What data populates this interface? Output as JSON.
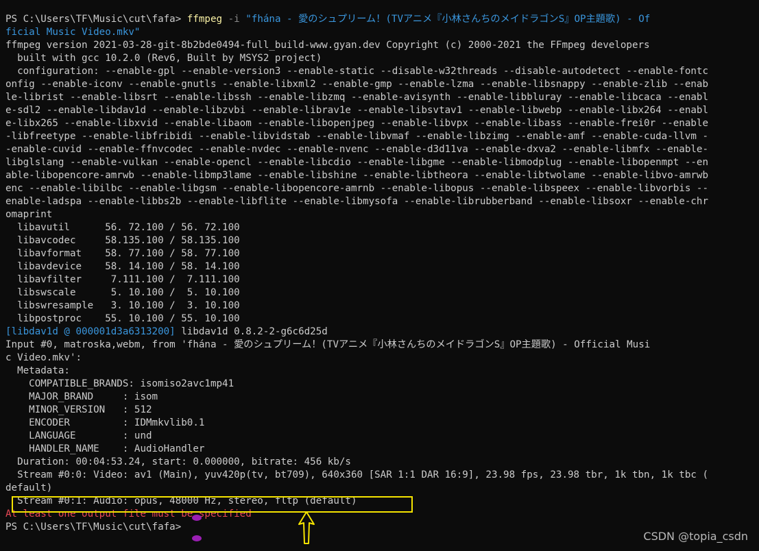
{
  "terminal": {
    "prompt": "PS C:\\Users\\TF\\Music\\cut\\fafa>",
    "command": "ffmpeg",
    "flag": "-i",
    "arg_line1": "\"fhána - 愛のシュプリーム！(TVアニメ『小林さんちのメイドラゴンS』OP主題歌) - Of",
    "arg_line2": "ficial Music Video.mkv\"",
    "lines": [
      "ffmpeg version 2021-03-28-git-8b2bde0494-full_build-www.gyan.dev Copyright (c) 2000-2021 the FFmpeg developers",
      "  built with gcc 10.2.0 (Rev6, Built by MSYS2 project)",
      "  configuration: --enable-gpl --enable-version3 --enable-static --disable-w32threads --disable-autodetect --enable-fontc",
      "onfig --enable-iconv --enable-gnutls --enable-libxml2 --enable-gmp --enable-lzma --enable-libsnappy --enable-zlib --enab",
      "le-librist --enable-libsrt --enable-libssh --enable-libzmq --enable-avisynth --enable-libbluray --enable-libcaca --enabl",
      "e-sdl2 --enable-libdav1d --enable-libzvbi --enable-librav1e --enable-libsvtav1 --enable-libwebp --enable-libx264 --enabl",
      "e-libx265 --enable-libxvid --enable-libaom --enable-libopenjpeg --enable-libvpx --enable-libass --enable-frei0r --enable",
      "-libfreetype --enable-libfribidi --enable-libvidstab --enable-libvmaf --enable-libzimg --enable-amf --enable-cuda-llvm -",
      "-enable-cuvid --enable-ffnvcodec --enable-nvdec --enable-nvenc --enable-d3d11va --enable-dxva2 --enable-libmfx --enable-",
      "libglslang --enable-vulkan --enable-opencl --enable-libcdio --enable-libgme --enable-libmodplug --enable-libopenmpt --en",
      "able-libopencore-amrwb --enable-libmp3lame --enable-libshine --enable-libtheora --enable-libtwolame --enable-libvo-amrwb",
      "enc --enable-libilbc --enable-libgsm --enable-libopencore-amrnb --enable-libopus --enable-libspeex --enable-libvorbis --",
      "enable-ladspa --enable-libbs2b --enable-libflite --enable-libmysofa --enable-librubberband --enable-libsoxr --enable-chr",
      "omaprint",
      "  libavutil      56. 72.100 / 56. 72.100",
      "  libavcodec     58.135.100 / 58.135.100",
      "  libavformat    58. 77.100 / 58. 77.100",
      "  libavdevice    58. 14.100 / 58. 14.100",
      "  libavfilter     7.111.100 /  7.111.100",
      "  libswscale      5. 10.100 /  5. 10.100",
      "  libswresample   3. 10.100 /  3. 10.100",
      "  libpostproc    55. 10.100 / 55. 10.100"
    ],
    "dav1d_tag": "[libdav1d @ 000001d3a6313200]",
    "dav1d_msg": " libdav1d 0.8.2-2-g6c6d25d",
    "input_lines": [
      "Input #0, matroska,webm, from 'fhána - 愛のシュプリーム！(TVアニメ『小林さんちのメイドラゴンS』OP主題歌) - Official Musi",
      "c Video.mkv':",
      "  Metadata:",
      "    COMPATIBLE_BRANDS: isomiso2avc1mp41",
      "    MAJOR_BRAND     : isom",
      "    MINOR_VERSION   : 512",
      "    ENCODER         : IDMmkvlib0.1",
      "    LANGUAGE        : und",
      "    HANDLER_NAME    : AudioHandler",
      "  Duration: 00:04:53.24, start: 0.000000, bitrate: 456 kb/s",
      "  Stream #0:0: Video: av1 (Main), yuv420p(tv, bt709), 640x360 [SAR 1:1 DAR 16:9], 23.98 fps, 23.98 tbr, 1k tbn, 1k tbc (",
      "default)",
      "  Stream #0:1: Audio: opus, 48000 Hz, stereo, fltp (default)"
    ],
    "error_line": "At least one output file must be specified",
    "final_prompt": "PS C:\\Users\\TF\\Music\\cut\\fafa>"
  },
  "watermark": "CSDN @topia_csdn",
  "colors": {
    "background": "#0c0c0c",
    "text": "#cccccc",
    "command": "#f9f1a5",
    "string": "#3a96dd",
    "error": "#e74856",
    "highlight": "#f5e400",
    "cursor": "#9a1fb3"
  }
}
